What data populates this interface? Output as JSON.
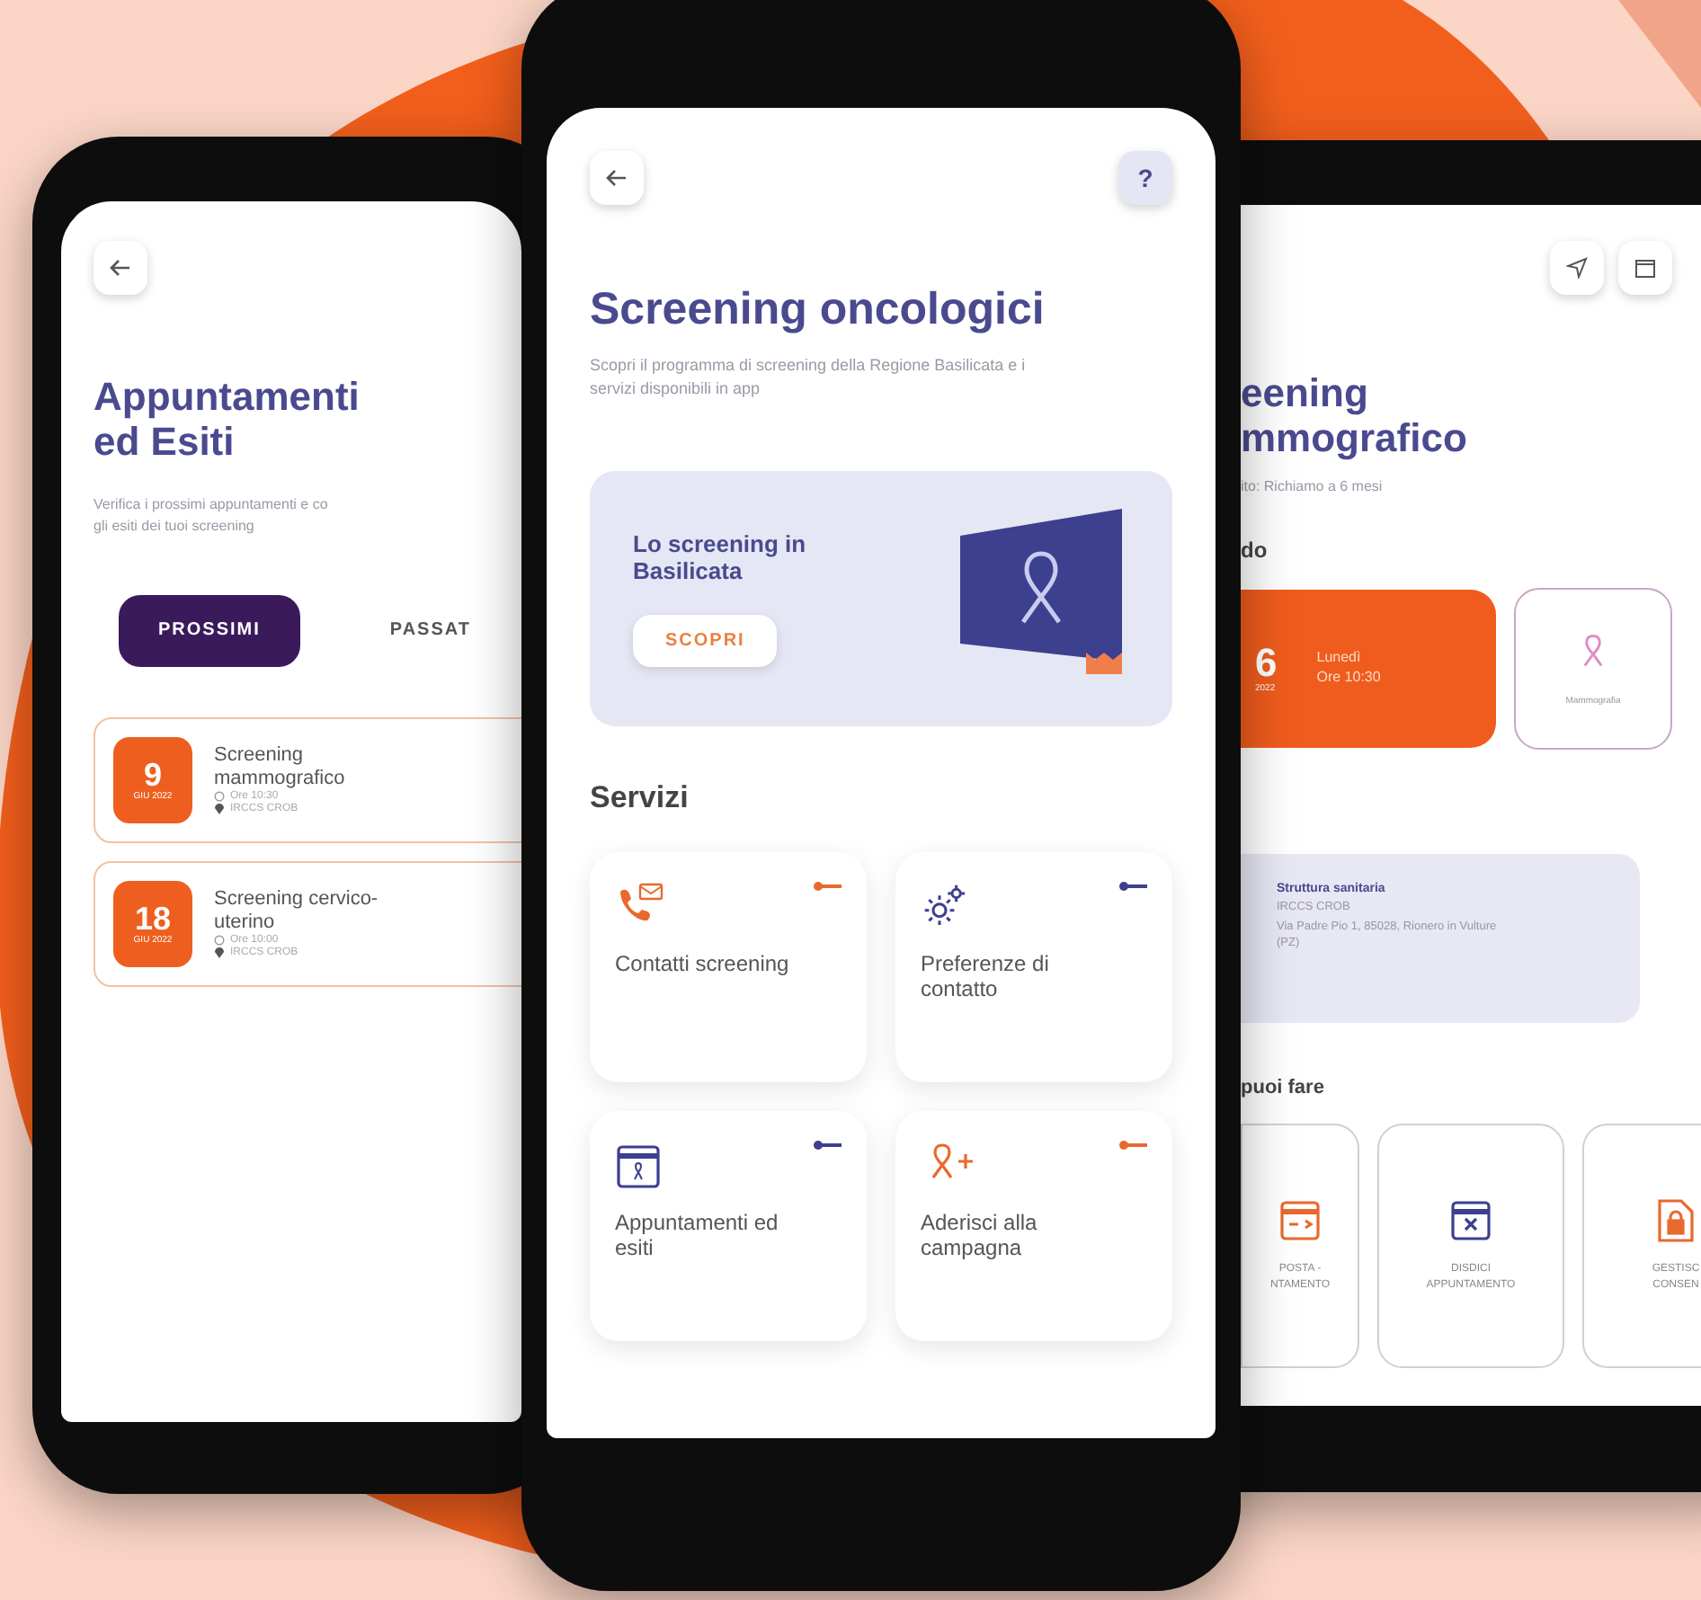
{
  "left_phone": {
    "title": "Appuntamenti ed Esiti",
    "subtitle_lines": [
      "Verifica i prossimi appuntamenti e co",
      "gli esiti dei tuoi screening"
    ],
    "tabs": [
      {
        "label": "PROSSIMI",
        "selected": true
      },
      {
        "label": "PASSAT",
        "selected": false
      }
    ],
    "appointments": [
      {
        "day": "9",
        "month": "GIU 2022",
        "title": "Screening mammografico",
        "time": "Ore 10:30",
        "place": "IRCCS CROB"
      },
      {
        "day": "18",
        "month": "GIU 2022",
        "title": "Screening cervico-uterino",
        "time": "Ore 10:00",
        "place": "IRCCS CROB"
      }
    ]
  },
  "center_phone": {
    "help": "?",
    "title": "Screening oncologici",
    "subtitle": "Scopri il programma di screening della Regione Basilicata e i servizi disponibili in app",
    "banner": {
      "title": "Lo screening in Basilicata",
      "button": "SCOPRI"
    },
    "section": "Servizi",
    "services": [
      {
        "kind": "contact",
        "label": "Contatti screening",
        "color": "#e8692e"
      },
      {
        "kind": "settings",
        "label": "Preferenze di contatto",
        "color": "#3d3f8f"
      },
      {
        "kind": "calendar",
        "label": "Appuntamenti ed esiti",
        "color": "#3d3f8f"
      },
      {
        "kind": "ribbon",
        "label": "Aderisci alla campagna",
        "color": "#e8692e"
      }
    ]
  },
  "right_phone": {
    "title_lines": [
      "eening",
      "mmografico"
    ],
    "subtitle": "ito: Richiamo a 6 mesi",
    "section": "do",
    "appointment": {
      "day": "6",
      "year": "2022",
      "weekday": "Lunedì",
      "time": "Ore 10:30"
    },
    "exam": "Mammografia",
    "facility": {
      "heading": "Struttura sanitaria",
      "name": "IRCCS CROB",
      "address": "Via Padre Pio 1, 85028, Rionero in Vulture (PZ)"
    },
    "actions_heading": "puoi fare",
    "actions": [
      {
        "kind": "move",
        "lines": [
          "POSTA -",
          "NTAMENTO"
        ],
        "color": "#e8692e"
      },
      {
        "kind": "cancel",
        "lines": [
          "DISDICI",
          "APPUNTAMENTO"
        ],
        "color": "#3d3f8f"
      },
      {
        "kind": "consent",
        "lines": [
          "GESTISC",
          "CONSEN"
        ],
        "color": "#e8692e"
      }
    ]
  }
}
